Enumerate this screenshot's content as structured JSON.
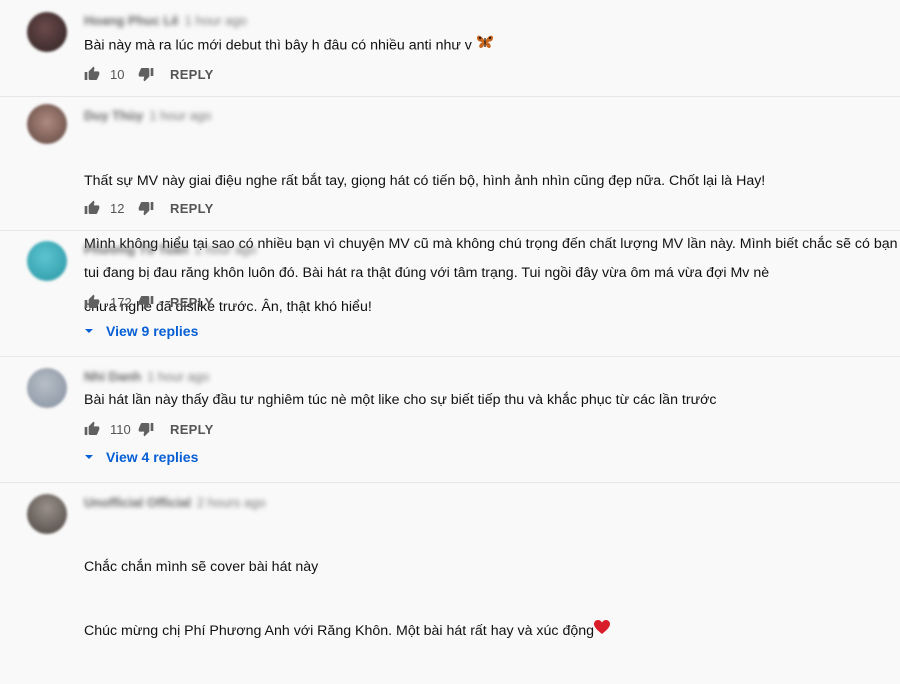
{
  "comments": [
    {
      "author": "Hoang Phuc Lê",
      "time": "1 hour ago",
      "lines": [
        "Bài này mà ra lúc mới debut thì bây h đâu có nhiều anti như v"
      ],
      "trailing_emoji": "butterfly-emoji",
      "likes": "10",
      "reply_label": "REPLY",
      "avatar_color": "#4a3535"
    },
    {
      "author": "Duy Thùy",
      "time": "1 hour ago",
      "lines": [
        "Thất sự MV này giai điệu nghe rất bắt tay, giọng hát có tiến bộ, hình ảnh nhìn cũng đẹp nữa. Chốt lại là Hay!",
        "Mình không hiểu tại sao có nhiều bạn vì chuyện MV cũ mà không chú trọng đến chất lượng MV lần này. Mình biết chắc sẽ có bạn",
        "chưa nghe đã dislike trước. Ân, thật khó hiểu!"
      ],
      "likes": "12",
      "reply_label": "REPLY",
      "avatar_color": "#8a6a63"
    },
    {
      "author": "Phương Tố Tuấn",
      "time": "1 hour ago",
      "lines": [
        "tui đang bị đau răng khôn luôn đó. Bài hát ra thật đúng với tâm trạng. Tui ngồi đây vừa ôm má vừa đợi Mv nè"
      ],
      "likes": "172",
      "reply_label": "REPLY",
      "view_replies": "View 9 replies",
      "avatar_color": "#34a7b5"
    },
    {
      "author": "Nhi Danh",
      "time": "1 hour ago",
      "lines": [
        "Bài hát lần này thấy đầu tư nghiêm túc nè một like cho sự biết tiếp thu và khắc phục từ các lần trước"
      ],
      "likes": "110",
      "reply_label": "REPLY",
      "view_replies": "View 4 replies",
      "avatar_color": "#9aa3ad"
    },
    {
      "author": "Unofficial Official",
      "time": "2 hours ago",
      "lines": [
        "Chắc chắn mình sẽ cover bài hát này",
        "Chúc mừng chị Phí Phương Anh với Răng Khôn. Một bài hát rất hay và xúc động"
      ],
      "trailing_emoji": "heart-emoji",
      "avatar_color": "#6e6660"
    }
  ],
  "colors": {
    "link": "#065fd4",
    "muted": "#606060",
    "background": "#f9f9f9"
  }
}
